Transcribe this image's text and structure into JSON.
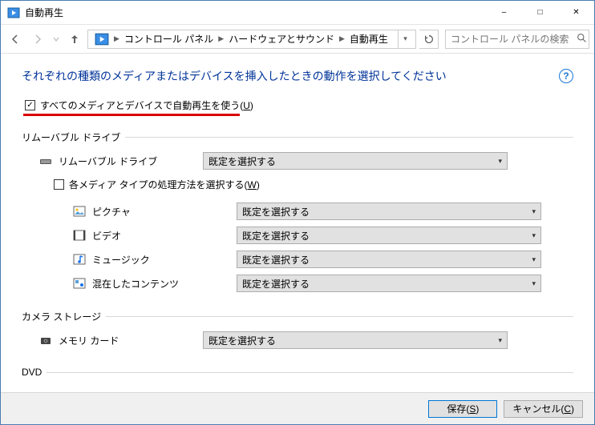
{
  "window": {
    "title": "自動再生"
  },
  "nav": {
    "breadcrumbs": [
      "コントロール パネル",
      "ハードウェアとサウンド",
      "自動再生"
    ],
    "search_placeholder": "コントロール パネルの検索"
  },
  "page": {
    "headline": "それぞれの種類のメディアまたはデバイスを挿入したときの動作を選択してください",
    "master_checkbox": {
      "label_before": "すべてのメディアとデバイスで自動再生を使う(",
      "accel": "U",
      "label_after": ")",
      "checked": true
    },
    "sections": {
      "removable": {
        "heading": "リムーバブル ドライブ",
        "item_label": "リムーバブル ドライブ",
        "combo": "既定を選択する",
        "sub_checkbox": {
          "label_before": "各メディア タイプの処理方法を選択する(",
          "accel": "W",
          "label_after": ")",
          "checked": false
        },
        "subitems": [
          {
            "icon": "picture-icon",
            "label": "ピクチャ",
            "combo": "既定を選択する"
          },
          {
            "icon": "video-icon",
            "label": "ビデオ",
            "combo": "既定を選択する"
          },
          {
            "icon": "music-icon",
            "label": "ミュージック",
            "combo": "既定を選択する"
          },
          {
            "icon": "mixed-icon",
            "label": "混在したコンテンツ",
            "combo": "既定を選択する"
          }
        ]
      },
      "camera": {
        "heading": "カメラ ストレージ",
        "item_label": "メモリ カード",
        "combo": "既定を選択する"
      },
      "dvd": {
        "heading": "DVD"
      }
    }
  },
  "footer": {
    "save": {
      "before": "保存(",
      "accel": "S",
      "after": ")"
    },
    "cancel": {
      "before": "キャンセル(",
      "accel": "C",
      "after": ")"
    }
  }
}
